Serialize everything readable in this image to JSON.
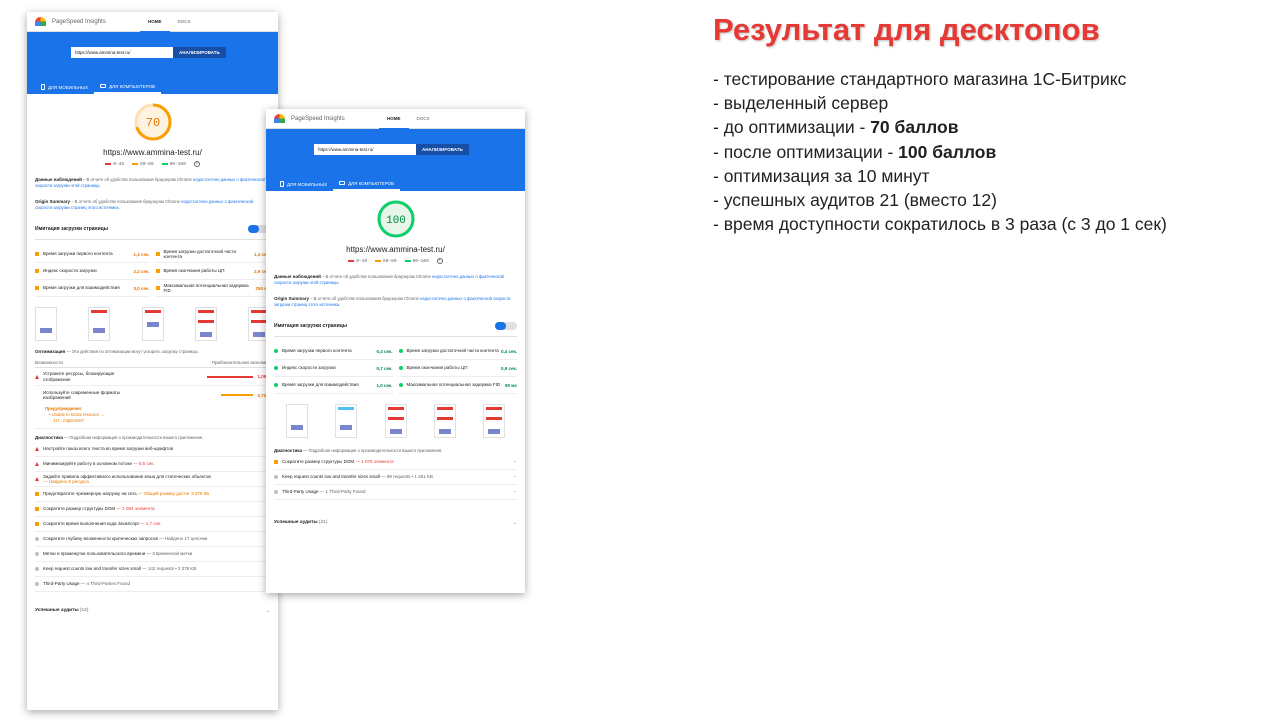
{
  "app": {
    "title": "PageSpeed Insights",
    "nav_home": "HOME",
    "nav_docs": "DOCS",
    "analyze_button": "АНАЛИЗИРОВАТЬ",
    "tab_mobile": "ДЛЯ МОБИЛЬНЫХ",
    "tab_desktop": "ДЛЯ КОМПЬЮТЕРОВ",
    "url_value": "https://www.ammina-test.ru/",
    "site_url": "https://www.ammina-test.ru/",
    "legend_poor": "0–49",
    "legend_avg": "50–89",
    "legend_good": "90–100",
    "field_title": "Данные наблюдений",
    "field_text": "– В отчете об удобстве пользования браузером Chrome",
    "field_link": "недостаточно данных о фактической скорости загрузки этой страницы.",
    "origin_title": "Origin Summary",
    "origin_text": "– В отчете об удобстве пользования браузером Chrome",
    "origin_link": "недостаточно данных о фактической скорости загрузки страниц этого источника.",
    "lab_title": "Имитация загрузки страницы",
    "metric_fcp": "Время загрузки первого контента",
    "metric_fmp": "Время загрузки достаточной части контента",
    "metric_si": "Индекс скорости загрузки",
    "metric_cpu": "Время окончания работы ЦП",
    "metric_tti": "Время загрузки для взаимодействия",
    "metric_fid": "Максимальная потенциальная задержка FID",
    "diag_title": "Диагностика",
    "diag_sub": "— Подробная информация о производительности вашего приложения.",
    "passed_title": "Успешные аудиты"
  },
  "before": {
    "score": "70",
    "score_value": 70,
    "metrics": {
      "fcp": "1,4 сек.",
      "fmp": "1,4 сек.",
      "si": "2,2 сек.",
      "cpu": "2,9 сек.",
      "tti": "3,0 сек.",
      "fid": "250 мс"
    },
    "opt_title": "Оптимизация",
    "opt_sub": "— Эти действия по оптимизации могут ускорить загрузку страницы.",
    "opt_col_left": "Возможности",
    "opt_col_right": "Приблизительная экономия",
    "opportunities": [
      {
        "name": "Устраните ресурсы, блокирующие отображение",
        "value": "1,09 s"
      },
      {
        "name": "Используйте современные форматы изображений",
        "value": "0,72 s"
      }
    ],
    "warning_title": "Предупреждения:",
    "warning_line1": "• Unable to locate resource ...",
    "warning_line2": "117.../ntpbv2xN?",
    "diagnostics": [
      {
        "name": "Настройте показ всего текста во время загрузки веб-шрифтов",
        "note": ""
      },
      {
        "name": "Минимизируйте работу в основном потоке",
        "note": "— 8,5 сек."
      },
      {
        "name": "Задайте правила эффективного использования кеша для статических объектов",
        "note": "— Найдено 9 ресурса"
      },
      {
        "name": "Предотвратите чрезмерную нагрузку на сеть",
        "note": "— Общий размер достиг 3 378 КБ"
      },
      {
        "name": "Сократите размер структуры DOM",
        "note": "— 1 084 элемента"
      },
      {
        "name": "Сократите время выполнения кода JavaScript",
        "note": "— 1,7 сек."
      },
      {
        "name": "Сократите глубину вложенности критических запросов",
        "note": "— Найдено 17 цепочки"
      },
      {
        "name": "Метки и промежутки пользовательского времени",
        "note": "— 3 временной метки"
      },
      {
        "name": "Keep request counts low and transfer sizes small",
        "note": "— 142 requests • 3 378 KB"
      },
      {
        "name": "Third-Party Usage",
        "note": "— 4 Third-Parties Found"
      }
    ],
    "passed_count": "(12)"
  },
  "after": {
    "score": "100",
    "score_value": 100,
    "metrics": {
      "fcp": "0,4 сек.",
      "fmp": "0,4 сек.",
      "si": "0,7 сек.",
      "cpu": "0,9 сек.",
      "tti": "1,0 сек.",
      "fid": "90 мс"
    },
    "diagnostics": [
      {
        "name": "Сократите размер структуры DOM",
        "note": "— 1 076 элемента"
      },
      {
        "name": "Keep request counts low and transfer sizes small",
        "note": "— 89 requests • 1 281 KB"
      },
      {
        "name": "Third-Party Usage",
        "note": "— 1 Third-Party Found"
      }
    ],
    "passed_count": "(21)"
  },
  "summary": {
    "title": "Результат для десктопов",
    "l1": "- тестирование стандартного магазина 1С-Битрикс",
    "l2": "- выделенный сервер",
    "l3_pre": "- до оптимизации - ",
    "l3_bold": "70 баллов",
    "l4_pre": "- после оптимизации - ",
    "l4_bold": "100 баллов",
    "l5": "- оптимизация за 10 минут",
    "l6": "- успешных аудитов 21 (вместо 12)",
    "l7": "- время доступности сократилось в 3 раза (с 3 до 1 сек)"
  },
  "colors": {
    "accent_blue": "#1a73e8",
    "poor": "#e53935",
    "average": "#fa9d00",
    "good": "#0cce6b",
    "title_red": "#e53935"
  }
}
